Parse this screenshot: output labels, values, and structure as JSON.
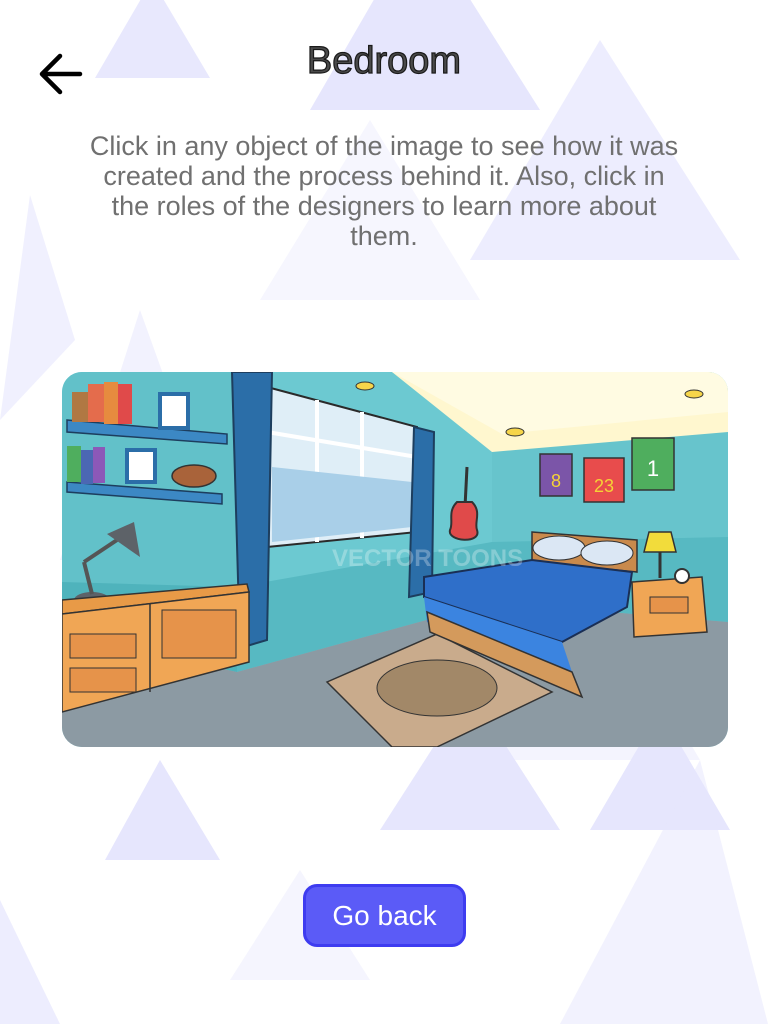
{
  "header": {
    "title": "Bedroom",
    "back_icon": "arrow-left-icon"
  },
  "main": {
    "instructions": "Click in any object of the image to see how it was created and the process behind it. Also, click in the roles of the designers to learn more about them.",
    "scene": {
      "jersey_numbers": [
        "8",
        "23",
        "1"
      ],
      "watermark": "VECTOR TOONS"
    }
  },
  "footer": {
    "go_back_label": "Go back"
  },
  "colors": {
    "accent": "#5b5bf7",
    "accent_border": "#3e3cf0",
    "background_shapes": "#e3e3fd"
  }
}
